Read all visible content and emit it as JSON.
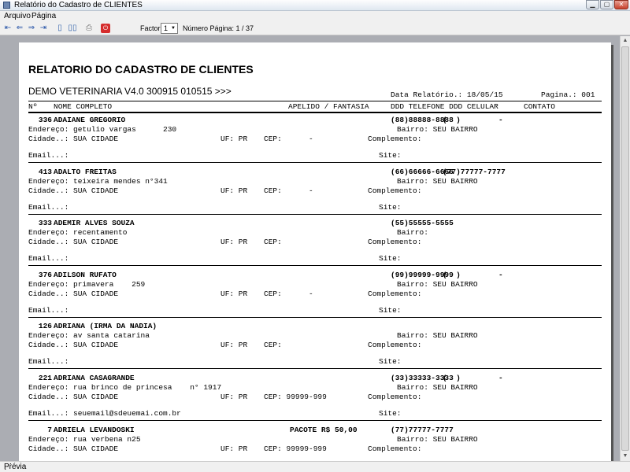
{
  "window": {
    "title": "Relatório do Cadastro de CLIENTES"
  },
  "menu": {
    "items": [
      "Arquivo",
      "Página"
    ]
  },
  "toolbar": {
    "factor_label": "Factor:",
    "factor_value": "1",
    "page_label": "Número Página: 1 / 37"
  },
  "report": {
    "title": "RELATORIO DO CADASTRO DE CLIENTES",
    "company": "DEMO VETERINARIA V4.0 300915 010515 >>>",
    "date": "Data Relatório.: 18/05/15",
    "page": "Pagina.: 001",
    "headers": {
      "num": "Nº",
      "name": "NOME COMPLETO",
      "alias": "APELIDO / FANTASIA",
      "phones": "DDD TELEFONE DDD CELULAR",
      "contact": "CONTATO"
    },
    "clients": [
      {
        "id": "336",
        "name": "ADAIANE GREGORIO",
        "pacote": "",
        "phone": "(88)88888-8888",
        "cell": "(  )",
        "contact": "-",
        "address": "Endereço: getulio vargas      230",
        "bairro": "Bairro: SEU BAIRRO",
        "cidade": "Cidade..: SUA CIDADE",
        "uf": "UF: PR",
        "cep": "CEP:      -",
        "complemento": "Complemento:",
        "email": "Email...:",
        "site": "Site:"
      },
      {
        "id": "413",
        "name": "ADALTO FREITAS",
        "pacote": "",
        "phone": "(66)66666-6666",
        "cell": "(77)77777-7777",
        "contact": "",
        "address": "Endereço: teixeira mendes n°341",
        "bairro": "Bairro: SEU BAIRRO",
        "cidade": "Cidade..: SUA CIDADE",
        "uf": "UF: PR",
        "cep": "CEP:      -",
        "complemento": "Complemento:",
        "email": "Email...:",
        "site": "Site:"
      },
      {
        "id": "333",
        "name": "ADEMIR ALVES SOUZA",
        "pacote": "",
        "phone": "(55)55555-5555",
        "cell": "",
        "contact": "",
        "address": "Endereço: recentamento",
        "bairro": "Bairro:",
        "cidade": "Cidade..: SUA CIDADE",
        "uf": "UF: PR",
        "cep": "CEP:",
        "complemento": "Complemento:",
        "email": "Email...:",
        "site": "Site:"
      },
      {
        "id": "376",
        "name": "ADILSON RUFATO",
        "pacote": "",
        "phone": "(99)99999-9999",
        "cell": "(  )",
        "contact": "-",
        "address": "Endereço: primavera    259",
        "bairro": "Bairro: SEU BAIRRO",
        "cidade": "Cidade..: SUA CIDADE",
        "uf": "UF: PR",
        "cep": "CEP:      -",
        "complemento": "Complemento:",
        "email": "Email...:",
        "site": "Site:"
      },
      {
        "id": "126",
        "name": "ADRIANA (IRMA DA NADIA)",
        "pacote": "",
        "phone": "",
        "cell": "",
        "contact": "",
        "address": "Endereço: av santa catarina",
        "bairro": "Bairro: SEU BAIRRO",
        "cidade": "Cidade..: SUA CIDADE",
        "uf": "UF: PR",
        "cep": "CEP:",
        "complemento": "Complemento:",
        "email": "Email...:",
        "site": "Site:"
      },
      {
        "id": "221",
        "name": "ADRIANA CASAGRANDE",
        "pacote": "",
        "phone": "(33)33333-3333",
        "cell": "(  )",
        "contact": "-",
        "address": "Endereço: rua brinco de princesa    n° 1917",
        "bairro": "Bairro: SEU BAIRRO",
        "cidade": "Cidade..: SUA CIDADE",
        "uf": "UF: PR",
        "cep": "CEP: 99999-999",
        "complemento": "Complemento:",
        "email": "Email...: seuemail@sdeuemai.com.br",
        "site": "Site:"
      },
      {
        "id": "7",
        "name": "ADRIELA LEVANDOSKI",
        "pacote": "PACOTE R$ 50,00",
        "phone": "(77)77777-7777",
        "cell": "",
        "contact": "",
        "address": "Endereço: rua verbena n25",
        "bairro": "Bairro: SEU BAIRRO",
        "cidade": "Cidade..: SUA CIDADE",
        "uf": "UF: PR",
        "cep": "CEP: 99999-999",
        "complemento": "Complemento:",
        "email": "",
        "site": ""
      }
    ]
  },
  "status": {
    "text": "Prévia"
  }
}
